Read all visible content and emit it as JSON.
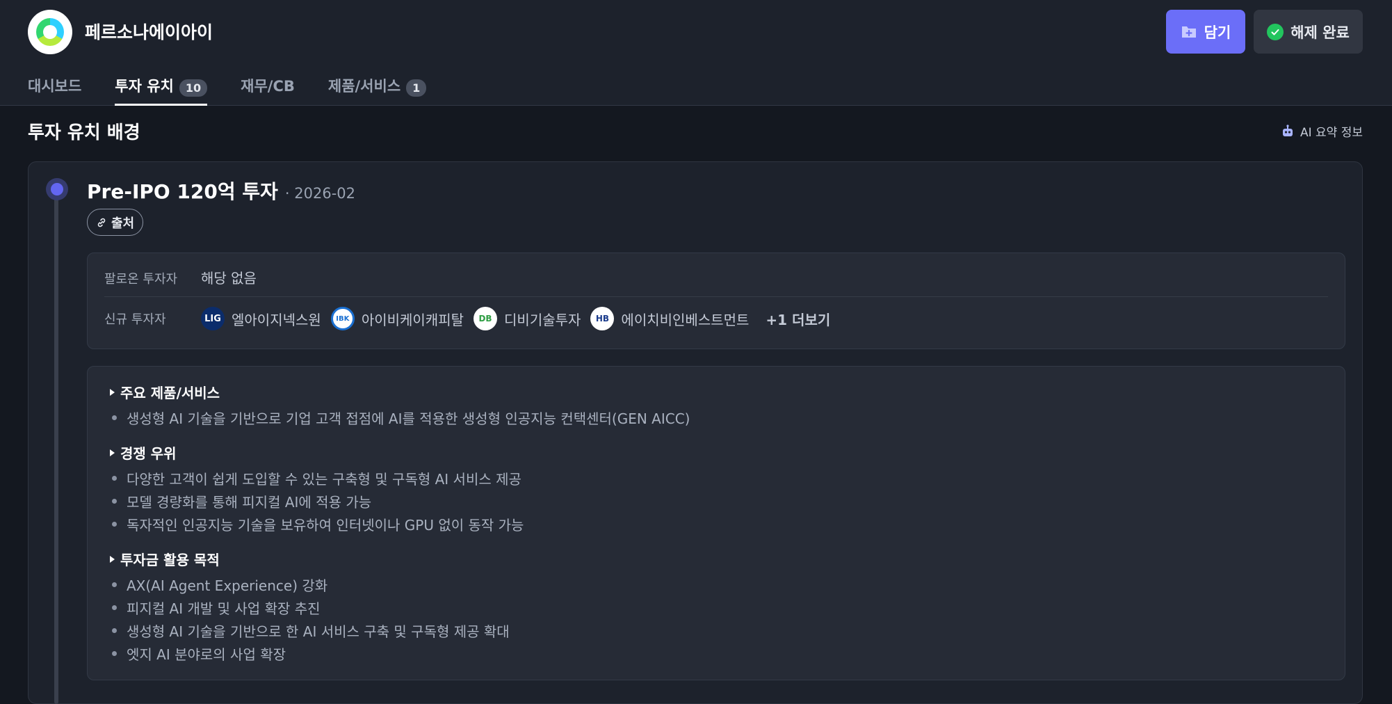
{
  "header": {
    "company_name": "페르소나에이아이",
    "save_label": "담기",
    "unlock_label": "해제 완료"
  },
  "tabs": [
    {
      "label": "대시보드",
      "count": ""
    },
    {
      "label": "투자 유치",
      "count": "10"
    },
    {
      "label": "재무/CB",
      "count": ""
    },
    {
      "label": "제품/서비스",
      "count": "1"
    }
  ],
  "section": {
    "title": "투자 유치 배경",
    "ai_summary_label": "AI 요약 정보"
  },
  "investment": {
    "title": "Pre-IPO 120억 투자",
    "date": "· 2026-02",
    "source_label": "출처",
    "follow_on_label": "팔로온 투자자",
    "follow_on_value": "해당 없음",
    "new_label": "신규 투자자",
    "new_investors": [
      {
        "name": "엘아이지넥스원",
        "logo_text": "LIG",
        "logo_bg": "#0b2c6b",
        "logo_fg": "#ffffff"
      },
      {
        "name": "아이비케이캐피탈",
        "logo_text": "IBK",
        "logo_bg": "#ffffff",
        "logo_fg": "#1a6fd1"
      },
      {
        "name": "디비기술투자",
        "logo_text": "DB",
        "logo_bg": "#ffffff",
        "logo_fg": "#2f9e44"
      },
      {
        "name": "에이치비인베스트먼트",
        "logo_text": "HB",
        "logo_bg": "#ffffff",
        "logo_fg": "#1b3c8c"
      }
    ],
    "more_label": "+1 더보기"
  },
  "details": {
    "products_heading": "주요 제품/서비스",
    "products": [
      "생성형 AI 기술을 기반으로 기업 고객 접점에 AI를 적용한 생성형 인공지능 컨택센터(GEN AICC)"
    ],
    "advantage_heading": "경쟁 우위",
    "advantages": [
      "다양한 고객이 쉽게 도입할 수 있는 구축형 및 구독형 AI 서비스 제공",
      "모델 경량화를 통해 피지컬 AI에 적용 가능",
      "독자적인 인공지능 기술을 보유하여 인터넷이나 GPU 없이 동작 가능"
    ],
    "usage_heading": "투자금 활용 목적",
    "usages": [
      "AX(AI Agent Experience) 강화",
      "피지컬 AI 개발 및 사업 확장 추진",
      "생성형 AI 기술을 기반으로 한 AI 서비스 구축 및 구독형 제공 확대",
      "엣지 AI 분야로의 사업 확장"
    ]
  }
}
